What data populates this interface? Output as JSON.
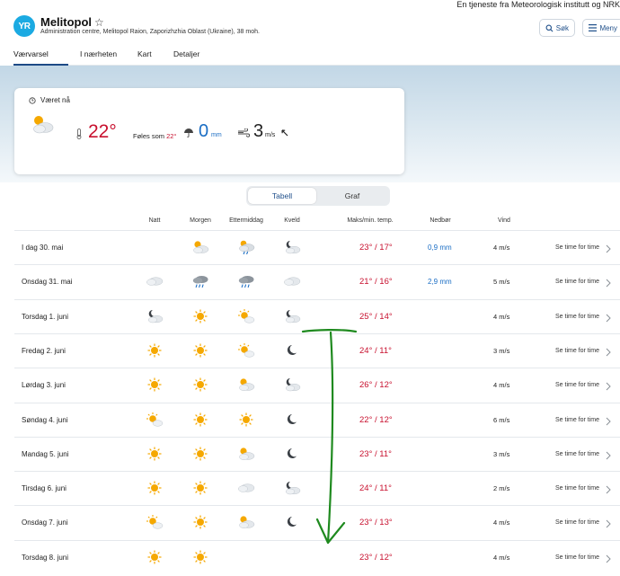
{
  "service_note": "En tjeneste fra Meteorologisk institutt og NRK",
  "header": {
    "logo_text": "YR",
    "place": "Melitopol",
    "subtitle": "Administration centre, Melitopol Raion, Zaporizhzhia Oblast (Ukraine), 38 moh.",
    "search_label": "Søk",
    "menu_label": "Meny"
  },
  "tabs": [
    {
      "label": "Værvarsel",
      "active": true
    },
    {
      "label": "I nærheten",
      "active": false
    },
    {
      "label": "Kart",
      "active": false
    },
    {
      "label": "Detaljer",
      "active": false
    }
  ],
  "now": {
    "title": "Været nå",
    "icon": "partly-cloudy-day-icon",
    "temp": "22°",
    "feels_label": "Føles som",
    "feels_value": "22°",
    "precip_value": "0",
    "precip_unit": "mm",
    "wind_value": "3",
    "wind_unit": "m/s"
  },
  "view_toggle": {
    "table": "Tabell",
    "graph": "Graf",
    "active": "Tabell"
  },
  "columns": {
    "natt": "Natt",
    "morgen": "Morgen",
    "ettermiddag": "Ettermiddag",
    "kveld": "Kveld",
    "temp": "Maks/min. temp.",
    "precip": "Nedbør",
    "wind": "Vind"
  },
  "colors": {
    "warm": "#c8102e",
    "precip": "#1a6dc4",
    "accent": "#1c4a86"
  },
  "rows": [
    {
      "day": "I dag 30. mai",
      "icons": [
        "",
        "partly-cloudy-day",
        "rain-showers-day",
        "partly-cloudy-night"
      ],
      "max": "23°",
      "min": "17°",
      "precip": "0,9 mm",
      "wind": "4 m/s",
      "link": "Se time for time"
    },
    {
      "day": "Onsdag 31. mai",
      "icons": [
        "cloudy",
        "rain",
        "rain",
        "cloudy"
      ],
      "max": "21°",
      "min": "16°",
      "precip": "2,9 mm",
      "wind": "5 m/s",
      "link": "Se time for time"
    },
    {
      "day": "Torsdag 1. juni",
      "icons": [
        "partly-cloudy-night",
        "sun",
        "fair-day",
        "partly-cloudy-night"
      ],
      "max": "25°",
      "min": "14°",
      "precip": "",
      "wind": "4 m/s",
      "link": "Se time for time"
    },
    {
      "day": "Fredag 2. juni",
      "icons": [
        "sun",
        "sun",
        "fair-day",
        "moon"
      ],
      "max": "24°",
      "min": "11°",
      "precip": "",
      "wind": "3 m/s",
      "link": "Se time for time"
    },
    {
      "day": "Lørdag 3. juni",
      "icons": [
        "sun",
        "sun",
        "partly-cloudy-day",
        "partly-cloudy-night"
      ],
      "max": "26°",
      "min": "12°",
      "precip": "",
      "wind": "4 m/s",
      "link": "Se time for time"
    },
    {
      "day": "Søndag 4. juni",
      "icons": [
        "fair-day",
        "sun",
        "sun",
        "moon"
      ],
      "max": "22°",
      "min": "12°",
      "precip": "",
      "wind": "6 m/s",
      "link": "Se time for time"
    },
    {
      "day": "Mandag 5. juni",
      "icons": [
        "sun",
        "sun",
        "partly-cloudy-day",
        "moon"
      ],
      "max": "23°",
      "min": "11°",
      "precip": "",
      "wind": "3 m/s",
      "link": "Se time for time"
    },
    {
      "day": "Tirsdag 6. juni",
      "icons": [
        "sun",
        "sun",
        "cloudy",
        "partly-cloudy-night"
      ],
      "max": "24°",
      "min": "11°",
      "precip": "",
      "wind": "2 m/s",
      "link": "Se time for time"
    },
    {
      "day": "Onsdag 7. juni",
      "icons": [
        "fair-day",
        "sun",
        "partly-cloudy-day",
        "moon"
      ],
      "max": "23°",
      "min": "13°",
      "precip": "",
      "wind": "4 m/s",
      "link": "Se time for time"
    },
    {
      "day": "Torsdag 8. juni",
      "icons": [
        "sun",
        "sun",
        "",
        ""
      ],
      "max": "23°",
      "min": "12°",
      "precip": "",
      "wind": "4 m/s",
      "link": "Se time for time"
    }
  ]
}
